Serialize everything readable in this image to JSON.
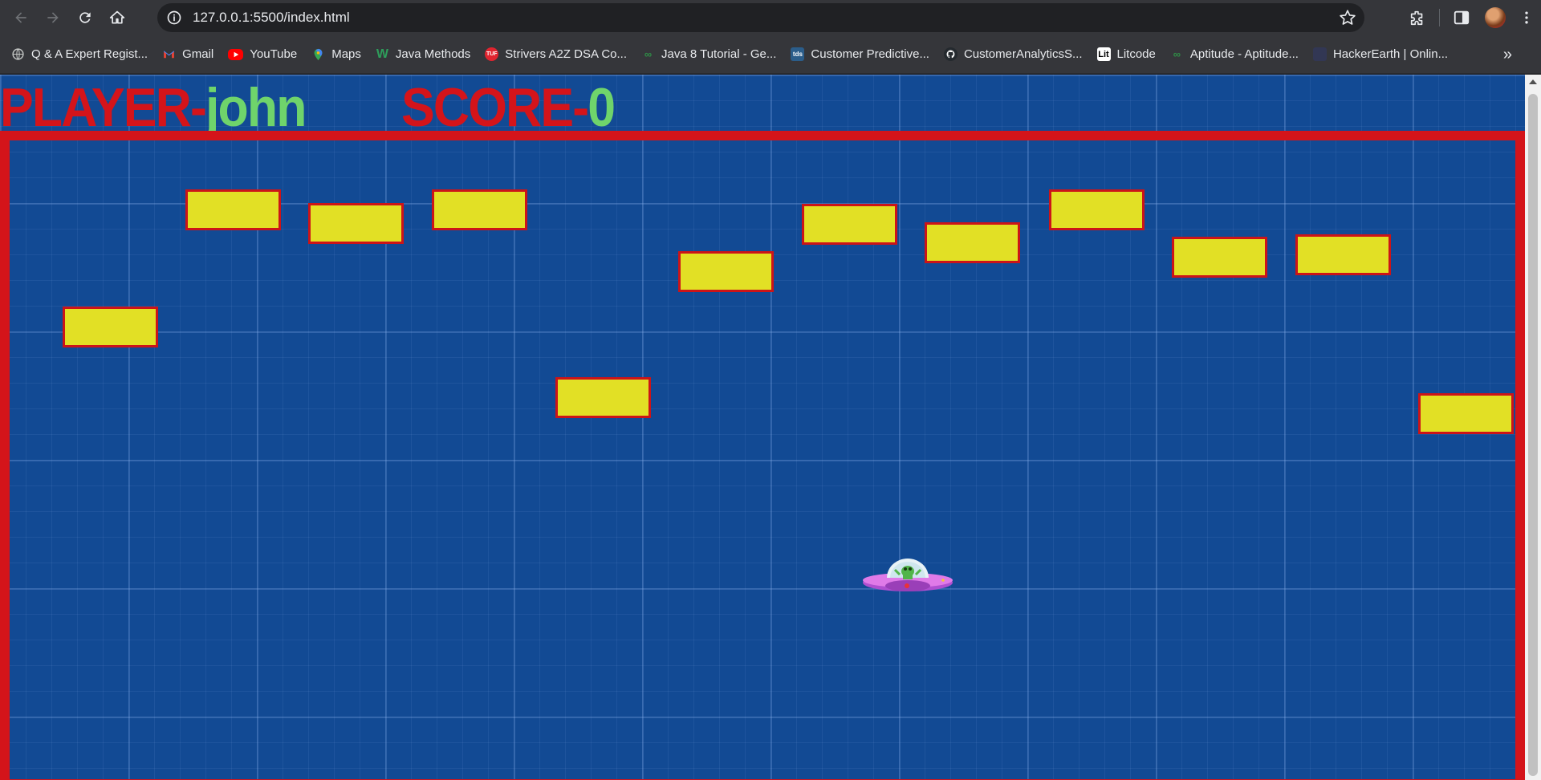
{
  "browser": {
    "url": "127.0.0.1:5500/index.html",
    "bookmarks": [
      {
        "label": "Q & A Expert Regist...",
        "icon": "globe-icon",
        "color": "#9aa0a6"
      },
      {
        "label": "Gmail",
        "icon": "gmail-icon",
        "color": "#ea4335"
      },
      {
        "label": "YouTube",
        "icon": "youtube-icon",
        "color": "#ff0000"
      },
      {
        "label": "Maps",
        "icon": "maps-icon",
        "color": "#34a853"
      },
      {
        "label": "Java Methods",
        "icon": "w-icon",
        "color": "#2e9e5b"
      },
      {
        "label": "Strivers A2Z DSA Co...",
        "icon": "tuf-icon",
        "color": "#e0242f"
      },
      {
        "label": "Java 8 Tutorial - Ge...",
        "icon": "gfg-icon",
        "color": "#2f8d46"
      },
      {
        "label": "Customer Predictive...",
        "icon": "tds-icon",
        "color": "#2b5d8a"
      },
      {
        "label": "CustomerAnalyticsS...",
        "icon": "github-icon",
        "color": "#24292e"
      },
      {
        "label": "Litcode",
        "icon": "lit-icon",
        "color": "#ffffff"
      },
      {
        "label": "Aptitude - Aptitude...",
        "icon": "gfg-icon",
        "color": "#2f8d46"
      },
      {
        "label": "HackerEarth | Onlin...",
        "icon": "hackerearth-icon",
        "color": "#323754"
      }
    ]
  },
  "game": {
    "player_label": "PLAYER-",
    "player_name": "john",
    "score_label": "SCORE-",
    "score_value": "0",
    "colors": {
      "background": "#124a94",
      "border": "#d4141a",
      "brick": "#e2e025",
      "label": "#d4141a",
      "value": "#6fd46b"
    },
    "ship": "ufo-icon"
  }
}
